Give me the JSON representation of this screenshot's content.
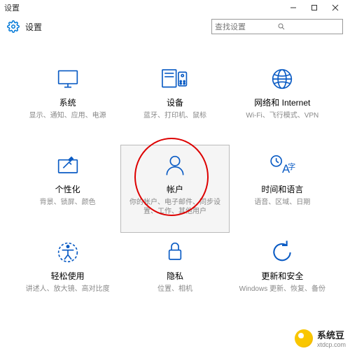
{
  "window": {
    "title": "设置"
  },
  "header": {
    "title": "设置"
  },
  "search": {
    "placeholder": "查找设置"
  },
  "tiles": [
    {
      "title": "系统",
      "sub": "显示、通知、应用、电源"
    },
    {
      "title": "设备",
      "sub": "蓝牙、打印机、鼠标"
    },
    {
      "title": "网络和 Internet",
      "sub": "Wi-Fi、飞行模式、VPN"
    },
    {
      "title": "个性化",
      "sub": "背景、锁屏、颜色"
    },
    {
      "title": "帐户",
      "sub": "你的帐户、电子邮件、同步设置、工作、其他用户"
    },
    {
      "title": "时间和语言",
      "sub": "语音、区域、日期"
    },
    {
      "title": "轻松使用",
      "sub": "讲述人、放大镜、高对比度"
    },
    {
      "title": "隐私",
      "sub": "位置、相机"
    },
    {
      "title": "更新和安全",
      "sub": "Windows 更新、恢复、备份"
    }
  ],
  "watermark": {
    "line1": "系统豆",
    "line2": "xtdcp.com"
  },
  "colors": {
    "accent": "#0a5bc4"
  }
}
